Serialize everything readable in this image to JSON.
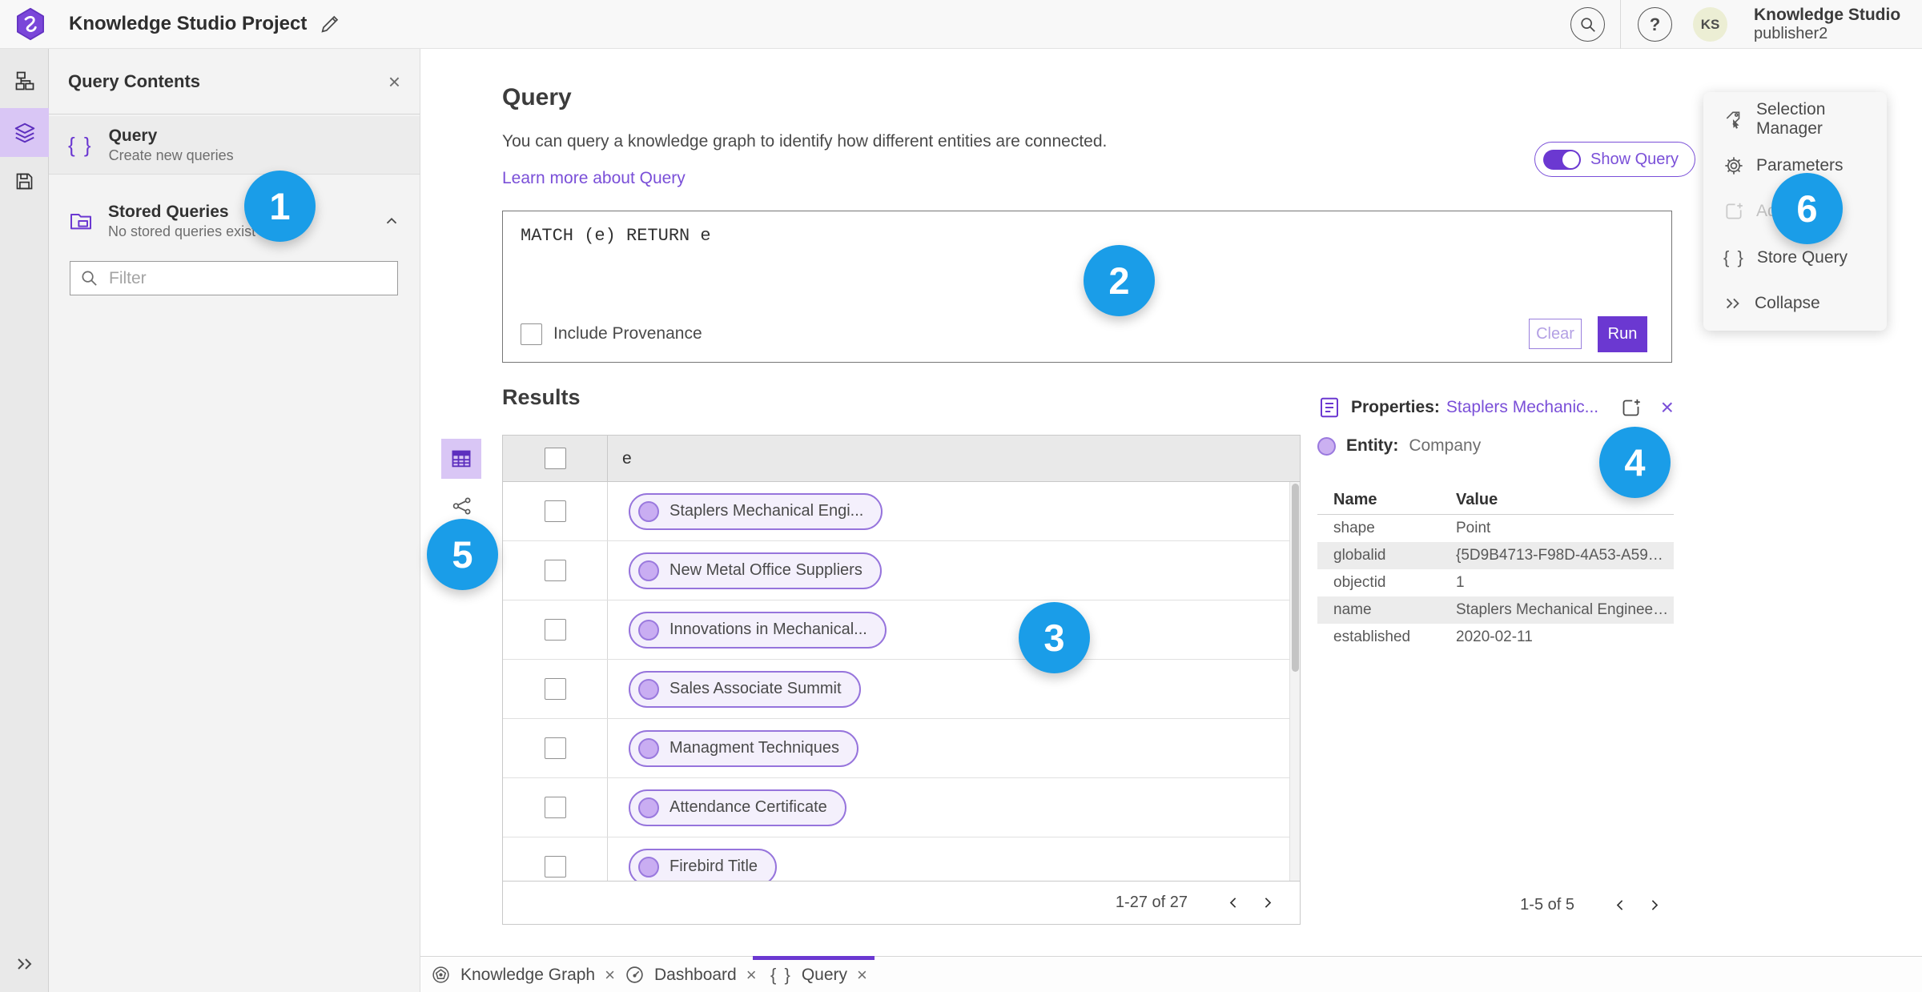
{
  "topbar": {
    "title": "Knowledge Studio Project",
    "user_initials": "KS",
    "user_name": "Knowledge Studio",
    "user_role": "publisher2",
    "help_glyph": "?"
  },
  "left_panel": {
    "title": "Query Contents",
    "close_glyph": "×",
    "query_item": {
      "title": "Query",
      "subtitle": "Create new queries",
      "icon_glyph": "{ }"
    },
    "stored": {
      "title": "Stored Queries",
      "subtitle": "No stored queries exist"
    },
    "filter_placeholder": "Filter"
  },
  "query": {
    "heading": "Query",
    "description": "You can query a knowledge graph to identify how different entities are connected.",
    "learn_more": "Learn more about Query",
    "show_query": "Show Query",
    "text": "MATCH (e) RETURN e",
    "include_provenance": "Include Provenance",
    "clear": "Clear",
    "run": "Run"
  },
  "results": {
    "heading": "Results",
    "column": "e",
    "rows": [
      "Staplers Mechanical Engi...",
      "New Metal Office Suppliers",
      "Innovations in Mechanical...",
      "Sales Associate Summit",
      "Managment Techniques",
      "Attendance Certificate",
      "Firebird Title"
    ],
    "pagination": "1-27 of 27"
  },
  "properties": {
    "heading": "Properties:",
    "entity_link": "Staplers Mechanic...",
    "close_glyph": "×",
    "entity_label": "Entity:",
    "entity_type": "Company",
    "col_name": "Name",
    "col_value": "Value",
    "rows": [
      {
        "name": "shape",
        "value": "Point"
      },
      {
        "name": "globalid",
        "value": "{5D9B4713-F98D-4A53-A59F-C11..."
      },
      {
        "name": "objectid",
        "value": "1"
      },
      {
        "name": "name",
        "value": "Staplers Mechanical Engineering"
      },
      {
        "name": "established",
        "value": "2020-02-11"
      }
    ],
    "pagination": "1-5 of 5"
  },
  "tools_menu": {
    "items": [
      {
        "label": "Selection Manager"
      },
      {
        "label": "Parameters"
      },
      {
        "label": "Ad",
        "disabled": true
      },
      {
        "label": "Store Query",
        "icon_glyph": "{ }"
      },
      {
        "label": "Collapse"
      }
    ]
  },
  "tabs": [
    {
      "label": "Knowledge Graph",
      "close_glyph": "×"
    },
    {
      "label": "Dashboard",
      "close_glyph": "×"
    },
    {
      "label": "Query",
      "close_glyph": "×",
      "icon_glyph": "{ }",
      "active": true
    }
  ],
  "callouts": [
    "1",
    "2",
    "3",
    "4",
    "5",
    "6"
  ],
  "icons": [
    "app-logo",
    "edit-pencil-icon",
    "search-icon",
    "help-icon",
    "schema-icon",
    "layers-icon",
    "save-icon",
    "expand-icon",
    "close-icon",
    "curly-braces-icon",
    "folder-icon",
    "chevron-up-icon",
    "table-icon",
    "link-chart-icon",
    "properties-icon",
    "add-new-icon",
    "selection-manager-icon",
    "gear-icon",
    "collapse-icon",
    "knowledge-graph-icon",
    "dashboard-icon",
    "chevron-left-icon",
    "chevron-right-icon"
  ],
  "colors": {
    "accent_purple": "#6b38d1",
    "link_purple": "#7a4fd8",
    "callout_blue": "#1a9de8",
    "selected_light_purple": "#d9c6f5"
  }
}
